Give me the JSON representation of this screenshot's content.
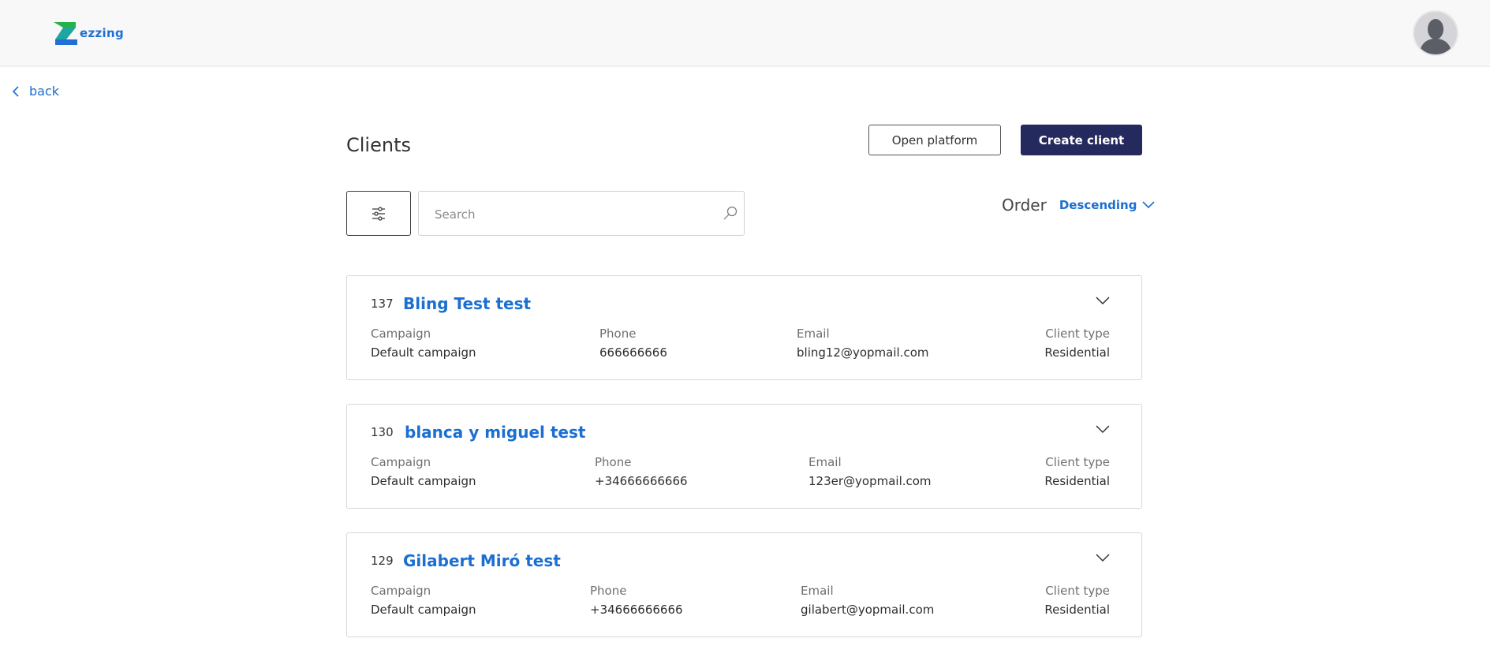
{
  "header": {
    "logo_text": "ezzing",
    "brand_colors": {
      "green": "#26b24b",
      "blue": "#1f6fd6"
    }
  },
  "nav": {
    "back_label": "back"
  },
  "page": {
    "title": "Clients",
    "open_platform_label": "Open platform",
    "create_client_label": "Create client"
  },
  "toolbar": {
    "search_placeholder": "Search",
    "order_label": "Order",
    "order_value": "Descending"
  },
  "clients": [
    {
      "id": "137",
      "name": "Bling Test test",
      "campaign_label": "Campaign",
      "campaign": "Default campaign",
      "phone_label": "Phone",
      "phone": "666666666",
      "email_label": "Email",
      "email": "bling12@yopmail.com",
      "type_label": "Client type",
      "type": "Residential"
    },
    {
      "id": "130",
      "name": "blanca y miguel test",
      "campaign_label": "Campaign",
      "campaign": "Default campaign",
      "phone_label": "Phone",
      "phone": "+34666666666",
      "email_label": "Email",
      "email": "123er@yopmail.com",
      "type_label": "Client type",
      "type": "Residential"
    },
    {
      "id": "129",
      "name": "Gilabert Miró test",
      "campaign_label": "Campaign",
      "campaign": "Default campaign",
      "phone_label": "Phone",
      "phone": "+34666666666",
      "email_label": "Email",
      "email": "gilabert@yopmail.com",
      "type_label": "Client type",
      "type": "Residential"
    }
  ],
  "colors": {
    "accent": "#1a6fd1",
    "primary_button": "#252a5e"
  }
}
